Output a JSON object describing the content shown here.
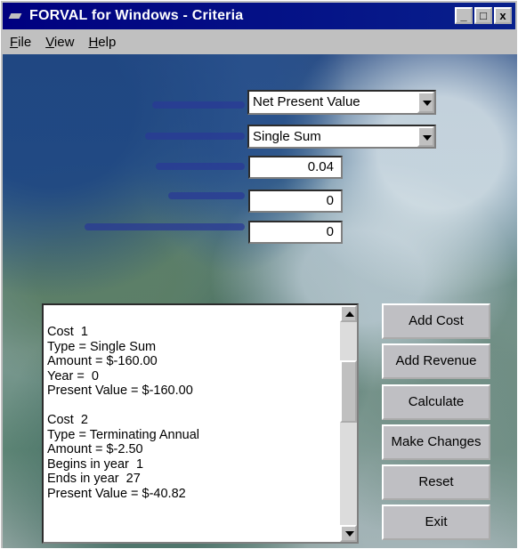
{
  "window": {
    "title": "FORVAL for Windows - Criteria"
  },
  "title_buttons": {
    "minimize": "_",
    "maximize": "□",
    "close": "x"
  },
  "menu": [
    {
      "label": "File"
    },
    {
      "label": "View"
    },
    {
      "label": "Help"
    }
  ],
  "criteria": {
    "analysis_select": {
      "value": "Net Present Value"
    },
    "type_select": {
      "value": "Single Sum"
    },
    "interest_rate": {
      "value": "0.04"
    },
    "field_two": {
      "value": "0"
    },
    "field_three": {
      "value": "0"
    }
  },
  "results_list": {
    "lines": [
      "Cost  1",
      "Type = Single Sum",
      "Amount = $-160.00",
      "Year =  0",
      "Present Value = $-160.00",
      "",
      "Cost  2",
      "Type = Terminating Annual",
      "Amount = $-2.50",
      "Begins in year  1",
      "Ends in year  27",
      "Present Value = $-40.82"
    ]
  },
  "actions": {
    "add_cost": {
      "label": "Add Cost"
    },
    "add_revenue": {
      "label": "Add Revenue"
    },
    "calculate": {
      "label": "Calculate"
    },
    "make_changes": {
      "label": "Make Changes"
    },
    "reset": {
      "label": "Reset"
    },
    "exit": {
      "label": "Exit"
    }
  },
  "colors": {
    "title_bar": "#000080",
    "face": "#c0c0c0",
    "label_blur": "#2a3a95"
  }
}
